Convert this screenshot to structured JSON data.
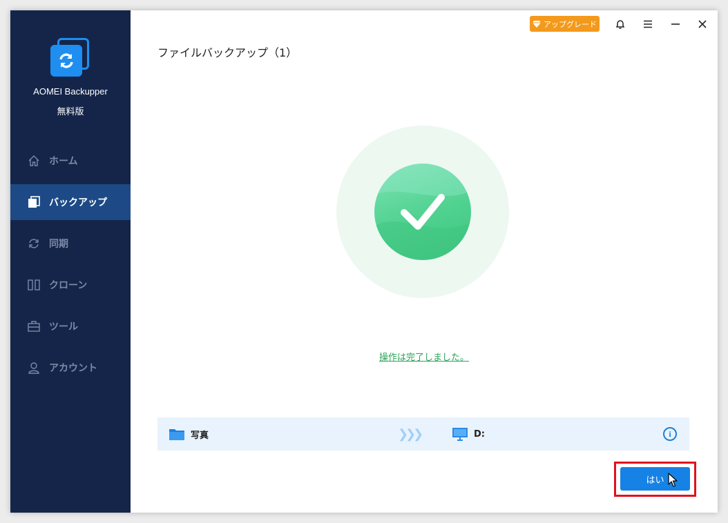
{
  "app": {
    "name": "AOMEI Backupper",
    "edition": "無料版"
  },
  "sidebar": {
    "items": [
      {
        "label": "ホーム",
        "icon": "home-icon",
        "active": false
      },
      {
        "label": "バックアップ",
        "icon": "backup-icon",
        "active": true
      },
      {
        "label": "同期",
        "icon": "sync-icon",
        "active": false
      },
      {
        "label": "クローン",
        "icon": "clone-icon",
        "active": false
      },
      {
        "label": "ツール",
        "icon": "toolbox-icon",
        "active": false
      },
      {
        "label": "アカウント",
        "icon": "user-icon",
        "active": false
      }
    ]
  },
  "titlebar": {
    "upgrade_label": "アップグレード"
  },
  "main": {
    "title": "ファイルバックアップ（1）",
    "status_message": "操作は完了しました。",
    "task": {
      "source": "写真",
      "destination": "D:"
    },
    "yes_button": "はい"
  },
  "colors": {
    "sidebar": "#15254a",
    "sidebar_active": "#1d4a86",
    "accent": "#1682e6",
    "success": "#4fd18f",
    "upgrade": "#f39a1c",
    "highlight": "#e0101e"
  }
}
